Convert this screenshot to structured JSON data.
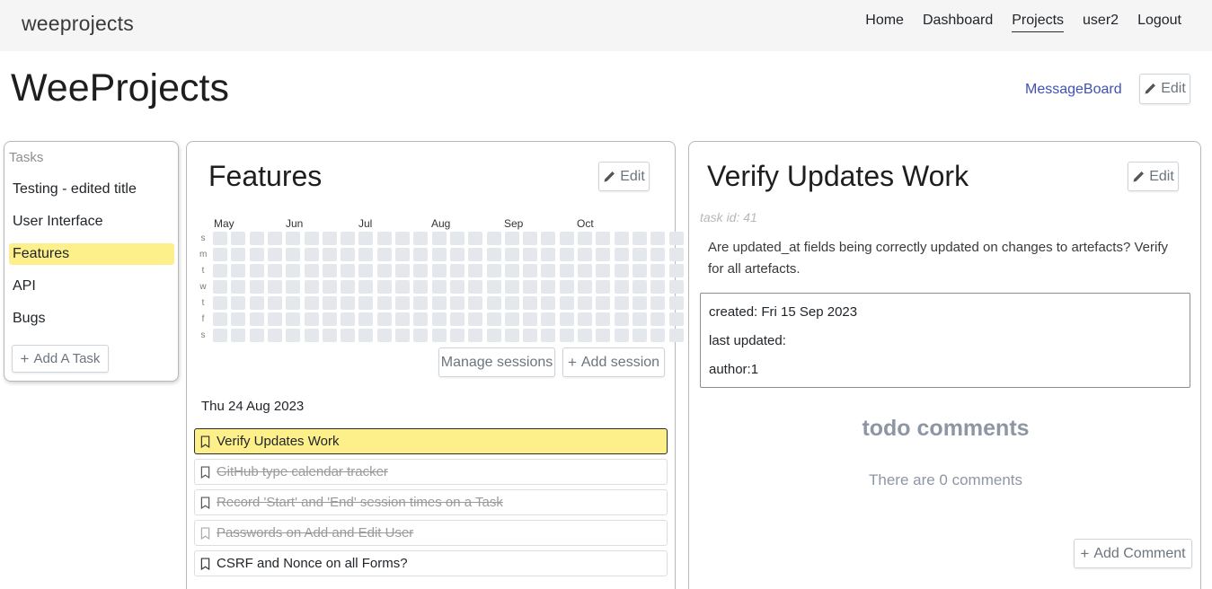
{
  "navbar": {
    "brand": "weeprojects",
    "links": [
      "Home",
      "Dashboard",
      "Projects",
      "user2",
      "Logout"
    ]
  },
  "page": {
    "title": "WeeProjects",
    "message_board": "MessageBoard",
    "edit_label": "Edit"
  },
  "tasks_panel": {
    "header": "Tasks",
    "items": [
      "Testing - edited title",
      "User Interface",
      "Features",
      "API",
      "Bugs"
    ],
    "selected": "Features",
    "add_label": "Add A Task"
  },
  "features_panel": {
    "title": "Features",
    "edit_label": "Edit",
    "calendar": {
      "months": [
        "May",
        "Jun",
        "Jul",
        "Aug",
        "Sep",
        "Oct"
      ],
      "day_labels": [
        "s",
        "m",
        "t",
        "w",
        "t",
        "f",
        "s"
      ]
    },
    "manage_sessions_label": "Manage sessions",
    "add_session_label": "Add session",
    "date_heading": "Thu 24 Aug 2023",
    "items": [
      {
        "label": "Verify Updates Work",
        "status": "active"
      },
      {
        "label": "GitHub type calendar tracker",
        "status": "done"
      },
      {
        "label": "Record 'Start' and 'End' session times on a Task",
        "status": "done"
      },
      {
        "label": "Passwords on Add and Edit User",
        "status": "done"
      },
      {
        "label": "CSRF and Nonce on all Forms?",
        "status": "open"
      }
    ]
  },
  "detail_panel": {
    "title": "Verify Updates Work",
    "edit_label": "Edit",
    "task_id": "task id: 41",
    "description": "Are updated_at fields being correctly updated on changes to artefacts? Verify for all artefacts.",
    "created": "created: Fri 15 Sep 2023",
    "last_updated": "last updated:",
    "author": "author:1",
    "comments_title": "todo comments",
    "comments_count": "There are 0 comments",
    "add_comment_label": "Add Comment"
  },
  "colors": {
    "accent_link": "#3f51b5",
    "highlight": "#fdef8a",
    "calendar_cell": "#e4e7eb"
  }
}
